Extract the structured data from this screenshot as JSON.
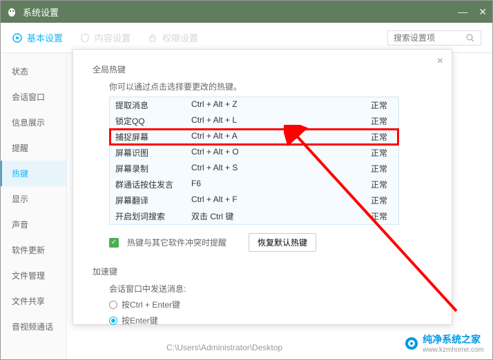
{
  "titlebar": {
    "title": "系统设置"
  },
  "tabs": [
    {
      "label": "基本设置",
      "active": true
    },
    {
      "label": "内容设置",
      "active": false
    },
    {
      "label": "权限设置",
      "active": false
    }
  ],
  "search": {
    "placeholder": "搜索设置项"
  },
  "sidebar": {
    "items": [
      {
        "label": "状态",
        "active": false
      },
      {
        "label": "会话窗口",
        "active": false
      },
      {
        "label": "信息展示",
        "active": false
      },
      {
        "label": "提醒",
        "active": false
      },
      {
        "label": "热键",
        "active": true
      },
      {
        "label": "显示",
        "active": false
      },
      {
        "label": "声音",
        "active": false
      },
      {
        "label": "软件更新",
        "active": false
      },
      {
        "label": "文件管理",
        "active": false
      },
      {
        "label": "文件共享",
        "active": false
      },
      {
        "label": "音视频通话",
        "active": false
      }
    ]
  },
  "hotkeys": {
    "section_title": "全局热键",
    "desc": "你可以通过点击选择要更改的热键。",
    "rows": [
      {
        "name": "提取消息",
        "key": "Ctrl + Alt + Z",
        "status": "正常",
        "highlighted": false
      },
      {
        "name": "锁定QQ",
        "key": "Ctrl + Alt + L",
        "status": "正常",
        "highlighted": false
      },
      {
        "name": "捕捉屏幕",
        "key": "Ctrl + Alt + A",
        "status": "正常",
        "highlighted": true
      },
      {
        "name": "屏幕识图",
        "key": "Ctrl + Alt + O",
        "status": "正常",
        "highlighted": false
      },
      {
        "name": "屏幕录制",
        "key": "Ctrl + Alt + S",
        "status": "正常",
        "highlighted": false
      },
      {
        "name": "群通话按住发言",
        "key": "F6",
        "status": "正常",
        "highlighted": false
      },
      {
        "name": "屏幕翻译",
        "key": "Ctrl + Alt + F",
        "status": "正常",
        "highlighted": false
      },
      {
        "name": "开启划词搜索",
        "key": "双击 Ctrl 键",
        "status": "正常",
        "highlighted": false
      }
    ],
    "conflict_label": "热键与其它软件冲突时提醒",
    "restore_btn": "恢复默认热键"
  },
  "accel": {
    "section_title": "加速键",
    "desc": "会话窗口中发送消息:",
    "options": [
      {
        "label": "按Ctrl + Enter键",
        "checked": false
      },
      {
        "label": "按Enter键",
        "checked": true
      }
    ]
  },
  "path": "C:\\Users\\Administrator\\Desktop",
  "watermark": {
    "text": "纯净系统之家",
    "url": "www.kzmhome.com"
  }
}
